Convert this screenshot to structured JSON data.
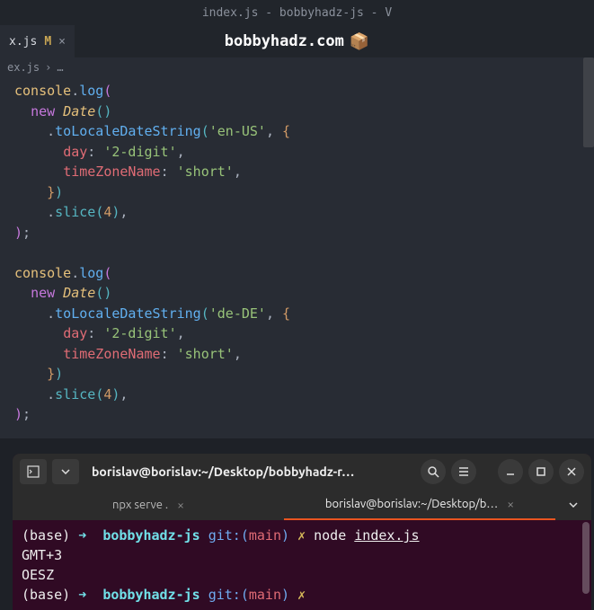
{
  "titleBar": "index.js - bobbyhadz-js - V",
  "tab": {
    "name": "x.js",
    "modified": "M",
    "close": "×"
  },
  "watermark": {
    "text": "bobbyhadz.com",
    "icon": "📦"
  },
  "breadcrumb": {
    "file": "ex.js",
    "sep": "›",
    "more": "…"
  },
  "code": {
    "console": "console",
    "log": "log",
    "new": "new",
    "Date": "Date",
    "toLocaleDateString": "toLocaleDateString",
    "enUS": "'en-US'",
    "deDE": "'de-DE'",
    "day": "day",
    "twoDigit": "'2-digit'",
    "timeZoneName": "timeZoneName",
    "short": "'short'",
    "slice": "slice",
    "four": "4"
  },
  "terminal": {
    "title": "borislav@borislav:~/Desktop/bobbyhadz-r…",
    "tabs": [
      {
        "label": "npx serve .",
        "active": false
      },
      {
        "label": "borislav@borislav:~/Desktop/b…",
        "active": true
      }
    ],
    "lines": {
      "base": "(base)",
      "arrow": "➜",
      "dir": "bobbyhadz-js",
      "git": "git:",
      "branch": "main",
      "x": "✗",
      "cmd": "node",
      "file": "index.js",
      "out1": "GMT+3",
      "out2": "OESZ"
    }
  }
}
